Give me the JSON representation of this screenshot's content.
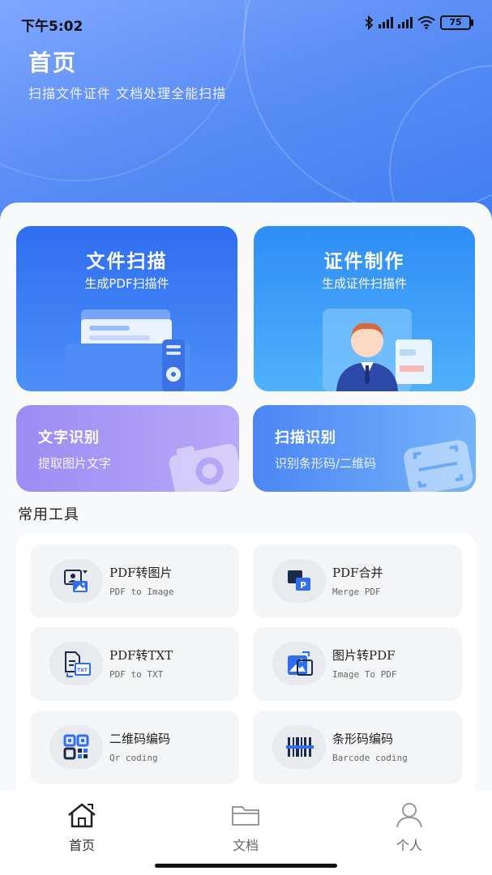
{
  "status_bar": {
    "time": "下午5:02",
    "battery": "75"
  },
  "header": {
    "title": "首页",
    "subtitle": "扫描文件证件 文档处理全能扫描"
  },
  "feature_cards": {
    "scan": {
      "title": "文件扫描",
      "subtitle": "生成PDF扫描件"
    },
    "cert": {
      "title": "证件制作",
      "subtitle": "生成证件扫描件"
    },
    "ocr": {
      "title": "文字识别",
      "subtitle": "提取图片文字"
    },
    "qr": {
      "title": "扫描识别",
      "subtitle": "识别条形码/二维码"
    }
  },
  "tools": {
    "section_title": "常用工具",
    "items": [
      {
        "name": "PDF转图片",
        "en": "PDF to Image",
        "icon": "pdf-to-image-icon"
      },
      {
        "name": "PDF合并",
        "en": "Merge PDF",
        "icon": "merge-pdf-icon"
      },
      {
        "name": "PDF转TXT",
        "en": "PDF to TXT",
        "icon": "pdf-to-txt-icon"
      },
      {
        "name": "图片转PDF",
        "en": "Image To PDF",
        "icon": "image-to-pdf-icon"
      },
      {
        "name": "二维码编码",
        "en": "Qr coding",
        "icon": "qr-code-icon"
      },
      {
        "name": "条形码编码",
        "en": "Barcode coding",
        "icon": "barcode-icon"
      }
    ]
  },
  "tabbar": {
    "items": [
      {
        "label": "首页",
        "icon": "home-icon",
        "active": true
      },
      {
        "label": "文档",
        "icon": "folder-icon",
        "active": false
      },
      {
        "label": "个人",
        "icon": "person-icon",
        "active": false
      }
    ]
  },
  "colors": {
    "accent": "#3e7cf0",
    "ocr_card": "#9c8cf3",
    "icon_blue": "#2f6ef0"
  }
}
